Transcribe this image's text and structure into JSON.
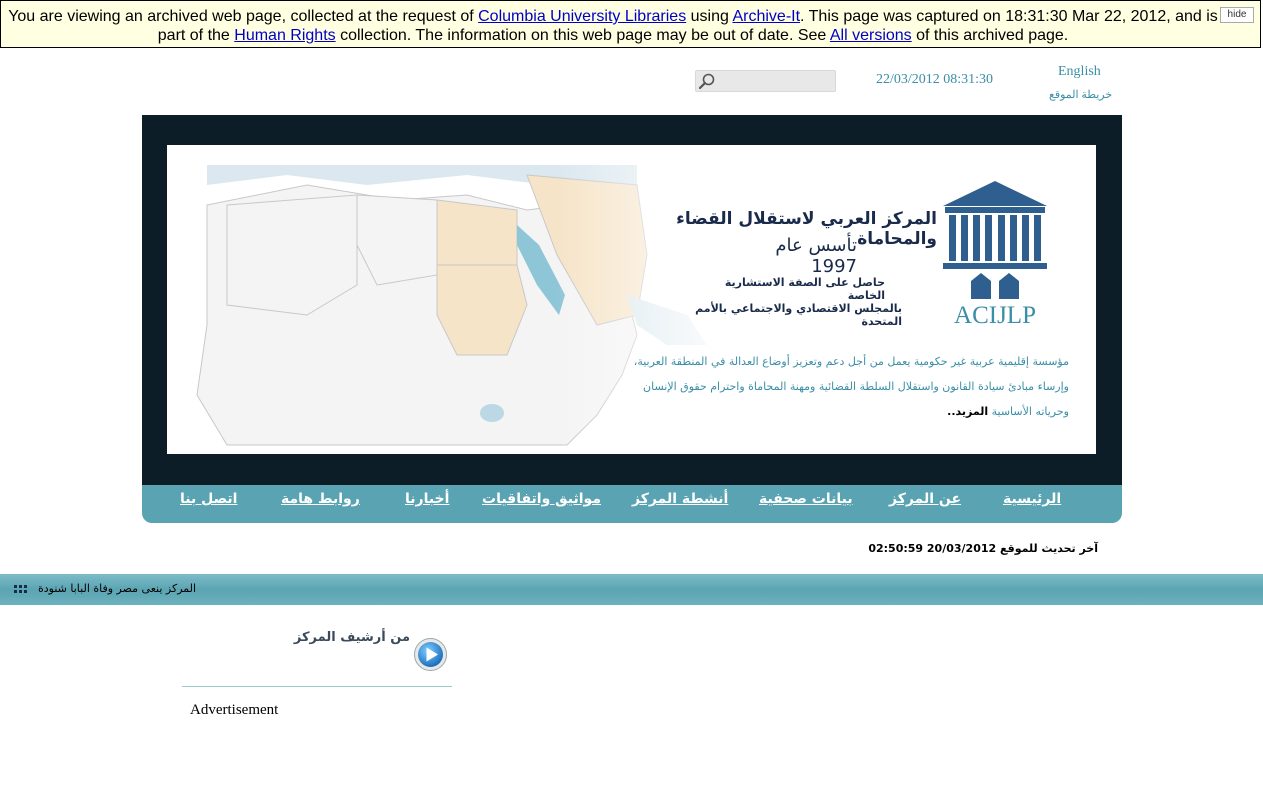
{
  "archive_banner": {
    "text_1": "You are viewing an archived web page, collected at the request of ",
    "link_columbia": "Columbia University Libraries",
    "text_2": " using ",
    "link_archiveit": "Archive-It",
    "text_3": ". This page was captured on 18:31:30 Mar 22, 2012, and is part of the ",
    "link_collection": "Human Rights",
    "text_4": " collection. The information on this web page may be out of date. See ",
    "link_versions": "All versions",
    "text_5": " of this archived page.",
    "hide_label": "hide"
  },
  "top_bar": {
    "search_placeholder": "",
    "date_now": "22/03/2012 08:31:30",
    "language_link": "English",
    "sitemap_link": "خريطة الموقع"
  },
  "header": {
    "org_name": "المركز العربي لاستقلال القضاء والمحاماة",
    "founded": "تأسس عام 1997",
    "consult_line_1": "حاصل على الصفة الاستشارية الخاصة",
    "consult_line_2": "بالمجلس الاقتصادي والاجتماعي بالأمم المتحدة",
    "logo_text": "ACIJLP",
    "mission": "مؤسسة إقليمية عربية غير حكومية يعمل من أجل دعم وتعزيز أوضاع العدالة في المنطقة العربية، وإرساء مبادئ سيادة القانون واستقلال السلطة القضائية ومهنة المحاماة واحترام حقوق الإنسان وحرياته الأساسية",
    "more_link": "المزيد.."
  },
  "nav": {
    "items": [
      {
        "label": "الرئيسية"
      },
      {
        "label": "عن المركز"
      },
      {
        "label": "بيانات صحفية"
      },
      {
        "label": "أنشطة المركز"
      },
      {
        "label": "مواثيق واتفاقيات"
      },
      {
        "label": "أخبارنا"
      },
      {
        "label": "روابط هامة"
      },
      {
        "label": "اتصل بنا"
      }
    ]
  },
  "last_update": "آخر تحديث للموقع 20/03/2012 02:50:59",
  "ticker": {
    "text": "المركز ينعى مصر وفاة البابا شنودة"
  },
  "archive_module": {
    "heading": "من أرشيف المركز",
    "ad_label": "Advertisement"
  },
  "colors": {
    "accent": "#5aa3b2",
    "header_bg": "#0c1d27",
    "link_teal": "#3a8ea6",
    "banner_bg": "#ffffe1"
  }
}
